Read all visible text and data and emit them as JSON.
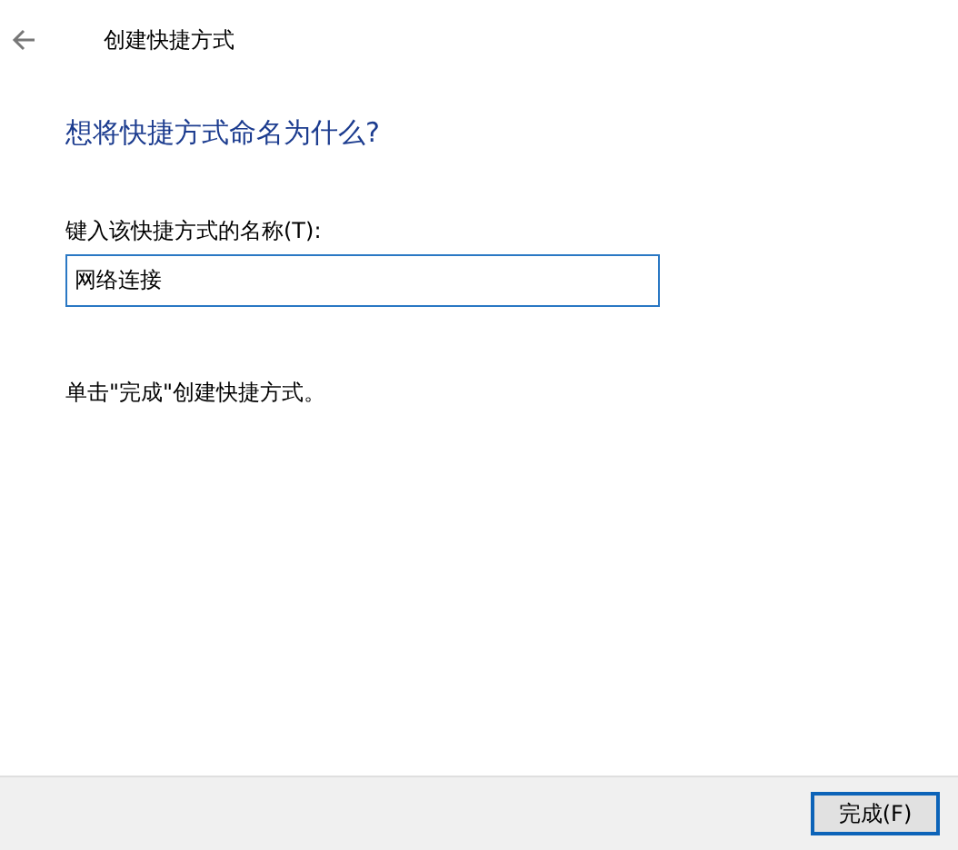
{
  "window": {
    "title": "创建快捷方式"
  },
  "heading": "想将快捷方式命名为什么?",
  "name_field": {
    "label": "键入该快捷方式的名称(T):",
    "value": "网络连接",
    "focused": true
  },
  "instruction": "单击\"完成\"创建快捷方式。",
  "buttons": [
    {
      "label": "完成(F)",
      "default": true
    }
  ]
}
